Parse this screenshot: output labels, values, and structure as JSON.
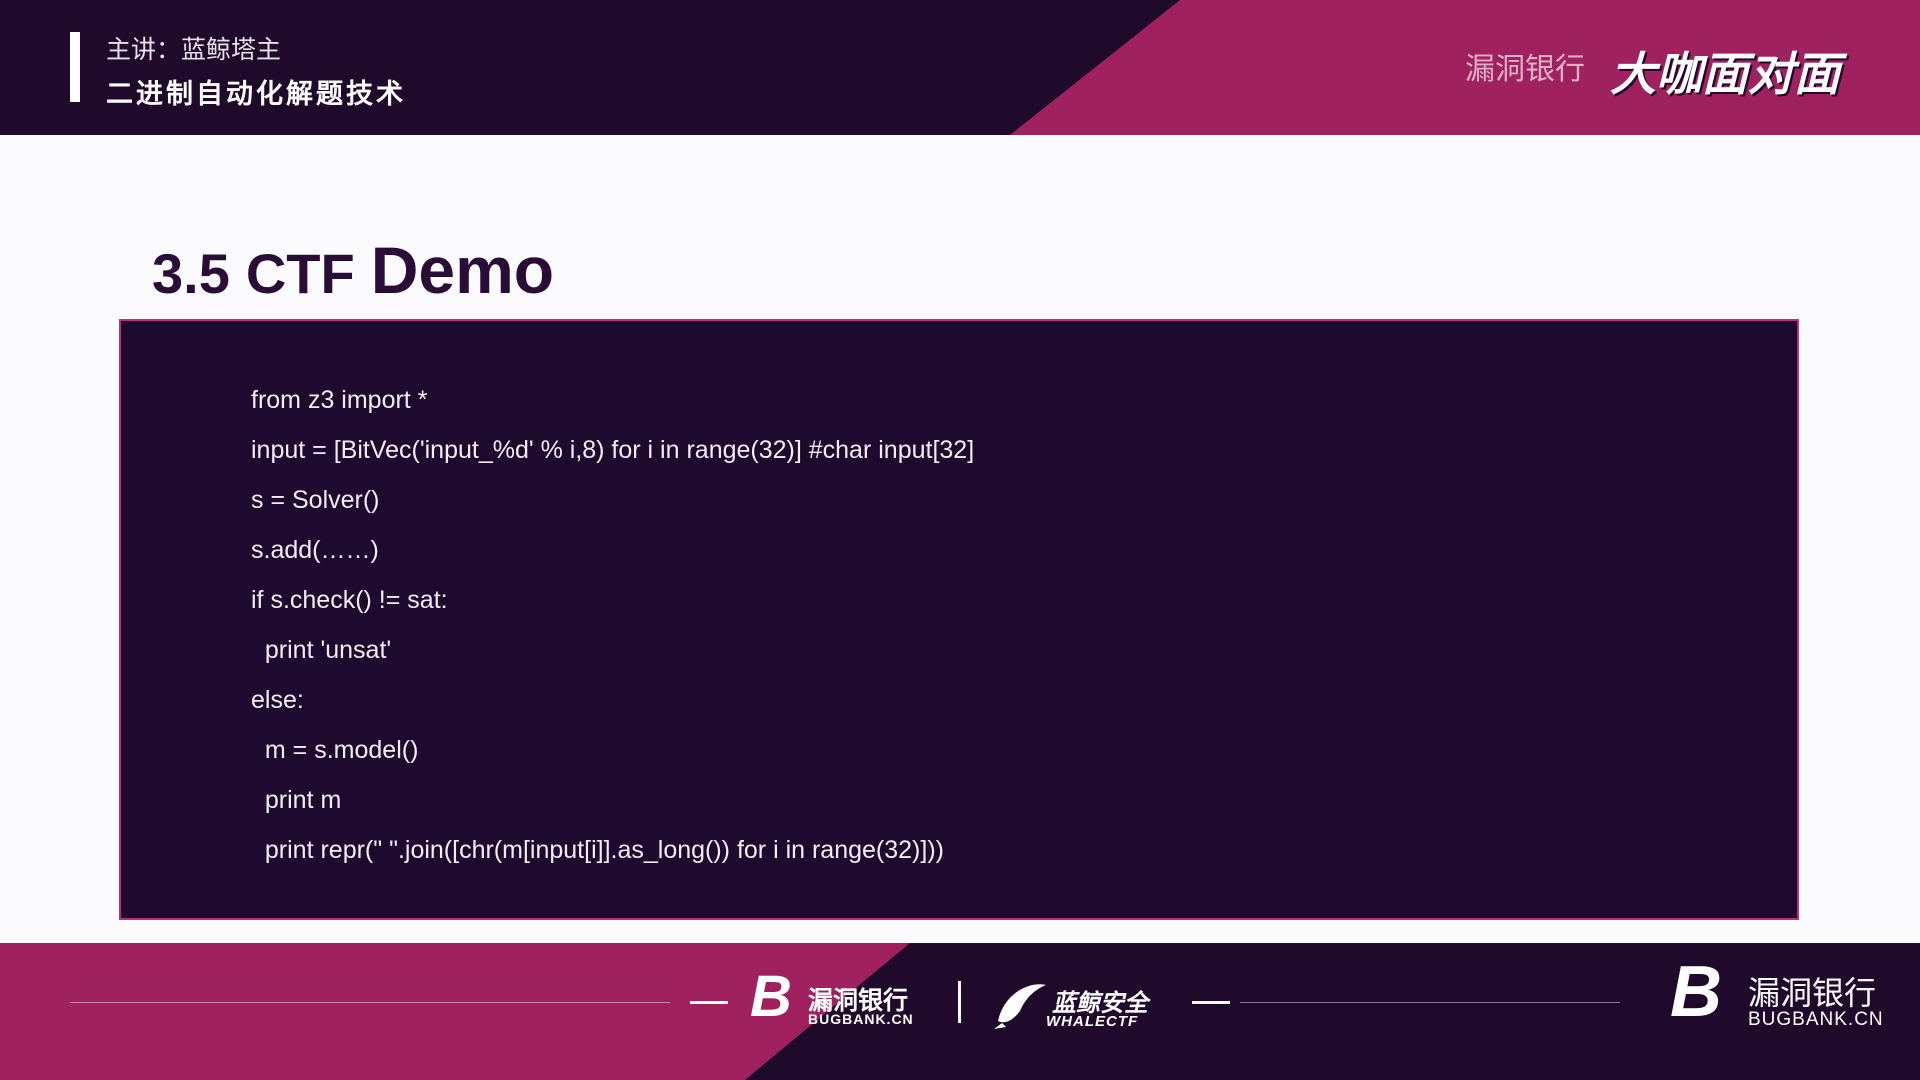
{
  "header": {
    "lecturer": "主讲：蓝鲸塔主",
    "course_title": "二进制自动化解题技术",
    "event_logo_text": "漏洞银行",
    "event_logo_mark": "大咖面对面"
  },
  "slide": {
    "title_num": "3.5",
    "title_ctf": "CTF",
    "title_demo": "Demo"
  },
  "code": {
    "lines": [
      "from z3 import *",
      "input = [BitVec('input_%d' % i,8) for i in range(32)] #char input[32]",
      "s = Solver()",
      "s.add(……)",
      "if s.check() != sat:",
      "  print 'unsat'",
      "else:",
      "  m = s.model()",
      "  print m",
      "  print repr(\" \".join([chr(m[input[i]].as_long()) for i in range(32)]))"
    ]
  },
  "footer": {
    "bugbank_cn": "漏洞银行",
    "bugbank_en": "BUGBANK.CN",
    "whale_cn": "蓝鲸安全",
    "whale_en": "WHALECTF",
    "bugbank_right_cn": "漏洞银行",
    "bugbank_right_en": "BUGBANK.CN"
  },
  "colors": {
    "header_bg": "#1f0a2c",
    "accent_magenta": "#a0215f",
    "code_bg": "#1e0a2e",
    "code_border": "#c0306f",
    "title_color": "#2a0d36"
  }
}
